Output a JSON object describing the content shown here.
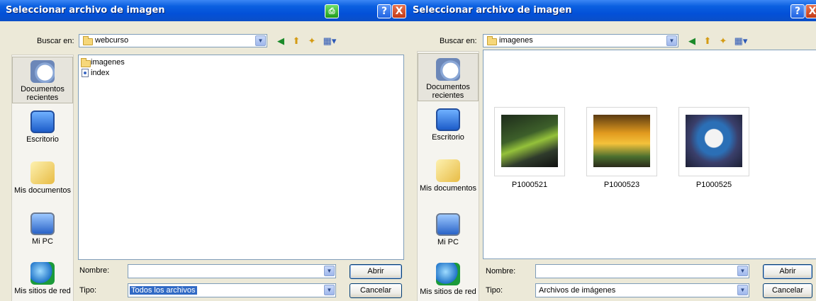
{
  "dialog1": {
    "title": "Seleccionar archivo de imagen",
    "buttons": {
      "help": "?",
      "close": "X"
    },
    "look_in_label": "Buscar en:",
    "look_in_value": "webcurso",
    "places": [
      "Documentos recientes",
      "Escritorio",
      "Mis documentos",
      "Mi PC",
      "Mis sitios de red"
    ],
    "files": [
      "imagenes",
      "index"
    ],
    "name_label": "Nombre:",
    "name_value": "",
    "type_label": "Tipo:",
    "type_value": "Todos los archivos",
    "open_label": "Abrir",
    "cancel_label": "Cancelar"
  },
  "dialog2": {
    "title": "Seleccionar archivo de imagen",
    "buttons": {
      "help": "?",
      "close": "X"
    },
    "look_in_label": "Buscar en:",
    "look_in_value": "imagenes",
    "places": [
      "Documentos recientes",
      "Escritorio",
      "Mis documentos",
      "Mi PC",
      "Mis sitios de red"
    ],
    "thumbnails": [
      {
        "caption": "P1000521"
      },
      {
        "caption": "P1000523"
      },
      {
        "caption": "P1000525"
      }
    ],
    "name_label": "Nombre:",
    "name_value": "",
    "type_label": "Tipo:",
    "type_value": "Archivos de imágenes",
    "open_label": "Abrir",
    "cancel_label": "Cancelar"
  },
  "colors": {
    "title_bar": "#0a5fe0",
    "selection": "#316ac5",
    "dialog_bg": "#ece9d8"
  }
}
